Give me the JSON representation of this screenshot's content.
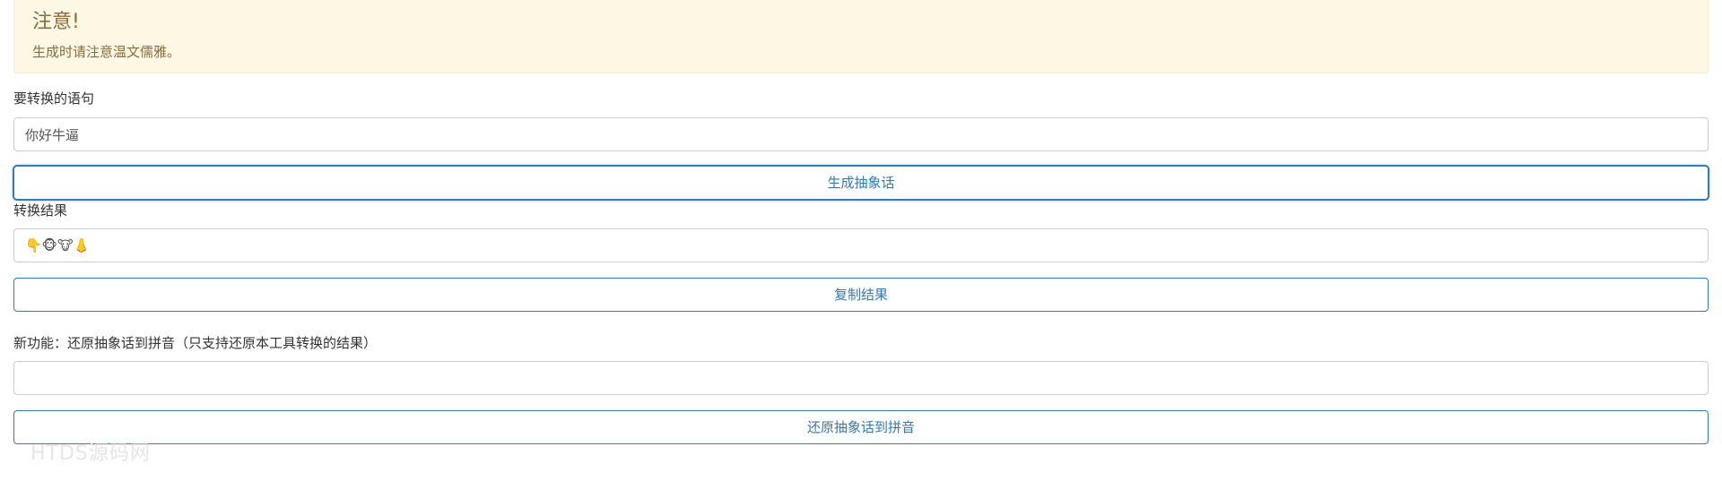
{
  "alert": {
    "title": "注意!",
    "message": "生成时请注意温文儒雅。",
    "color": "#8a6d3b",
    "background": "#fcf8e3"
  },
  "form": {
    "input_label": "要转换的语句",
    "input_value": "你好牛逼",
    "generate_button": "生成抽象话",
    "result_label": "转换结果",
    "result_value": "👇🐵🐮👃",
    "copy_button": "复制结果",
    "restore_label": "新功能：还原抽象话到拼音（只支持还原本工具转换的结果）",
    "restore_value": "",
    "restore_button": "还原抽象话到拼音"
  },
  "watermark": "HTDS源码网",
  "colors": {
    "button_accent": "#337ab7",
    "input_border": "#cccccc"
  }
}
